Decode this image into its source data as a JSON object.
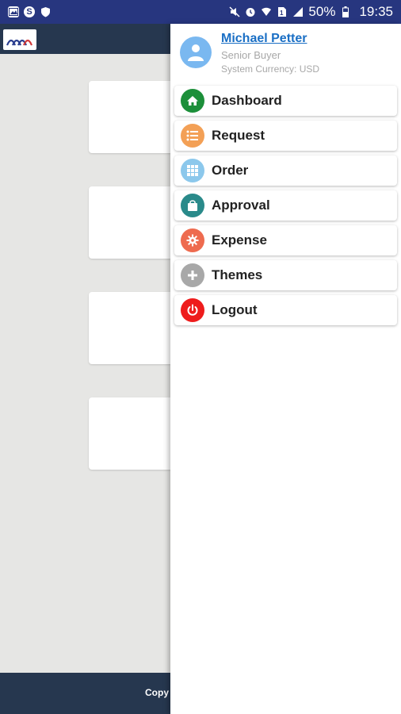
{
  "status_bar": {
    "battery": "50%",
    "time": "19:35",
    "left_icons": [
      "gallery-icon",
      "skype-icon",
      "shield-icon"
    ],
    "right_icons": [
      "mute-icon",
      "alarm-icon",
      "wifi-icon",
      "sim-icon",
      "signal-icon",
      "battery-icon"
    ]
  },
  "footer": {
    "text": "Copy"
  },
  "drawer": {
    "profile": {
      "name": "Michael Petter",
      "role": "Senior Buyer",
      "currency": "System Currency: USD"
    },
    "menu": [
      {
        "label": "Dashboard",
        "icon": "home-icon",
        "color": "#1c8f3a"
      },
      {
        "label": "Request",
        "icon": "list-icon",
        "color": "#f3a056"
      },
      {
        "label": "Order",
        "icon": "grid-icon",
        "color": "#8cc8ec"
      },
      {
        "label": "Approval",
        "icon": "shopping-bag-icon",
        "color": "#2a8a8a"
      },
      {
        "label": "Expense",
        "icon": "gear-icon",
        "color": "#ee6b4f"
      },
      {
        "label": "Themes",
        "icon": "plus-icon",
        "color": "#a8a8a8"
      },
      {
        "label": "Logout",
        "icon": "power-icon",
        "color": "#ee1c1c"
      }
    ]
  }
}
